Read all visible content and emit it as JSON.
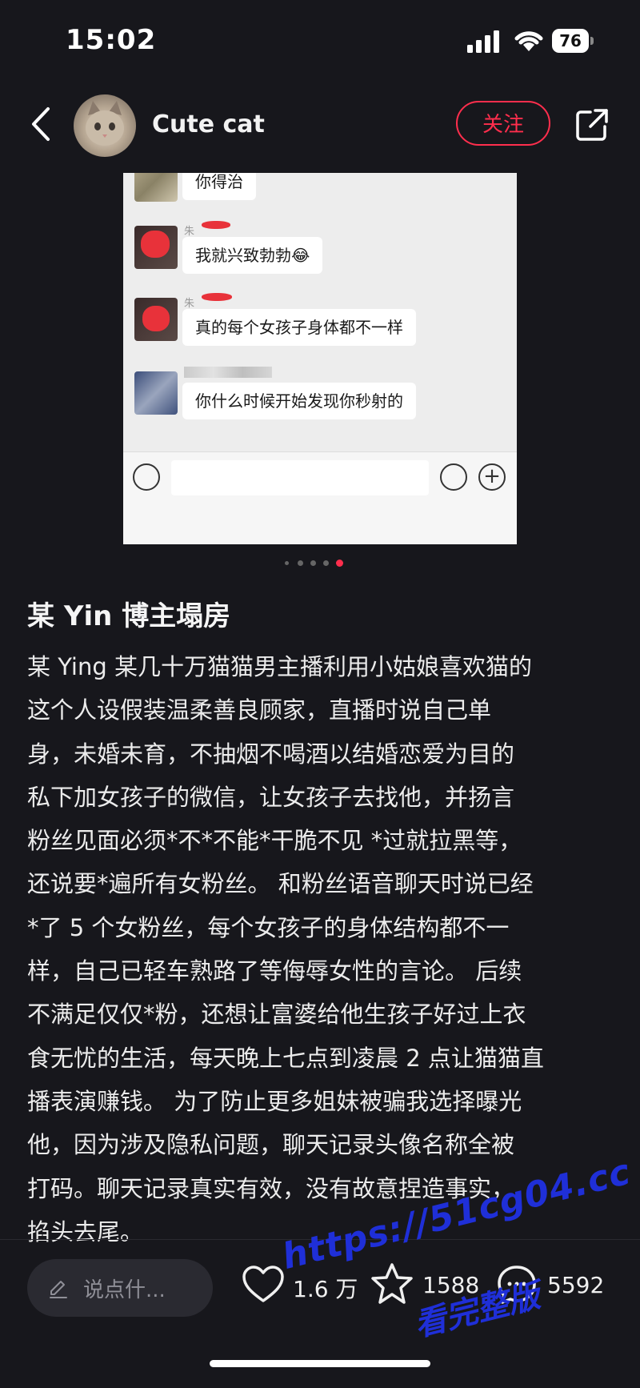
{
  "status_bar": {
    "time": "15:02",
    "battery": "76"
  },
  "header": {
    "author": "Cute cat",
    "follow_label": "关注"
  },
  "screenshot": {
    "messages": [
      {
        "text": "你得治"
      },
      {
        "sender": "朱",
        "text": "我就兴致勃勃😂"
      },
      {
        "sender": "朱",
        "text": "真的每个女孩子身体都不一样"
      },
      {
        "text": "你什么时候开始发现你秒射的"
      }
    ]
  },
  "carousel": {
    "count": 5,
    "active_index": 4
  },
  "post": {
    "title": "某 Yin 博主塌房",
    "lines": [
      "某 Ying 某几十万猫猫男主播利用小姑娘喜欢猫的",
      "这个人设假装温柔善良顾家，直播时说自己单",
      "身，未婚未育，不抽烟不喝酒以结婚恋爱为目的",
      "私下加女孩子的微信，让女孩子去找他，并扬言",
      "粉丝见面必须*不*不能*干脆不见 *过就拉黑等，",
      "还说要*遍所有女粉丝。 和粉丝语音聊天时说已经",
      "*了 5 个女粉丝，每个女孩子的身体结构都不一",
      "样，自己已轻车熟路了等侮辱女性的言论。 后续",
      "不满足仅仅*粉，还想让富婆给他生孩子好过上衣",
      "食无忧的生活，每天晚上七点到凌晨 2 点让猫猫直",
      "播表演赚钱。 为了防止更多姐妹被骗我选择曝光",
      "他，因为涉及隐私问题，聊天记录头像名称全被",
      "打码。聊天记录真实有效，没有故意捏造事实，",
      "掐头去尾。"
    ]
  },
  "bottom_bar": {
    "comment_placeholder": "说点什...",
    "likes": "1.6 万",
    "favorites": "1588",
    "comments": "5592"
  },
  "watermark": {
    "line1": "https://51cg04.cc",
    "line2": "看完整版"
  },
  "colors": {
    "accent": "#ff2e4d",
    "background": "#17171c",
    "watermark": "#1f2fd8"
  }
}
